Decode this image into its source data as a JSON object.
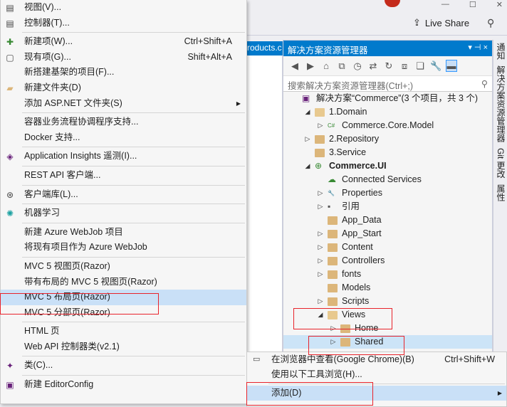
{
  "titlebar": {
    "live_share": "Live Share"
  },
  "editor": {
    "tab_fragment": "roducts.c"
  },
  "solution_explorer": {
    "title": "解决方案资源管理器",
    "title_controls": "▾ ⊣ ×",
    "search_placeholder": "搜索解决方案资源管理器(Ctrl+;)",
    "tree": [
      {
        "label": "解决方案“Commerce”(3 个项目，共 3 个)",
        "level": 0,
        "arrow": "",
        "icon": "solution-icon"
      },
      {
        "label": "1.Domain",
        "level": 1,
        "arrow": "◢",
        "icon": "folder-open-icon"
      },
      {
        "label": "Commerce.Core.Model",
        "level": 2,
        "arrow": "▷",
        "icon": "csharp-project-icon"
      },
      {
        "label": "2.Repository",
        "level": 1,
        "arrow": "▷",
        "icon": "folder-icon"
      },
      {
        "label": "3.Service",
        "level": 1,
        "arrow": "",
        "icon": "folder-icon"
      },
      {
        "label": "Commerce.UI",
        "level": 1,
        "arrow": "◢",
        "icon": "web-project-icon",
        "bold": true
      },
      {
        "label": "Connected Services",
        "level": 2,
        "arrow": "",
        "icon": "connected-services-icon"
      },
      {
        "label": "Properties",
        "level": 2,
        "arrow": "▷",
        "icon": "wrench-icon"
      },
      {
        "label": "引用",
        "level": 2,
        "arrow": "▷",
        "icon": "references-icon"
      },
      {
        "label": "App_Data",
        "level": 2,
        "arrow": "",
        "icon": "folder-icon"
      },
      {
        "label": "App_Start",
        "level": 2,
        "arrow": "▷",
        "icon": "folder-icon"
      },
      {
        "label": "Content",
        "level": 2,
        "arrow": "▷",
        "icon": "folder-icon"
      },
      {
        "label": "Controllers",
        "level": 2,
        "arrow": "▷",
        "icon": "folder-icon"
      },
      {
        "label": "fonts",
        "level": 2,
        "arrow": "▷",
        "icon": "folder-icon"
      },
      {
        "label": "Models",
        "level": 2,
        "arrow": "",
        "icon": "folder-icon"
      },
      {
        "label": "Scripts",
        "level": 2,
        "arrow": "▷",
        "icon": "folder-icon"
      },
      {
        "label": "Views",
        "level": 2,
        "arrow": "◢",
        "icon": "folder-open-icon"
      },
      {
        "label": "Home",
        "level": 3,
        "arrow": "▷",
        "icon": "folder-icon"
      },
      {
        "label": "Shared",
        "level": 3,
        "arrow": "▷",
        "icon": "folder-icon",
        "selected": true
      }
    ]
  },
  "vertical_tabs": [
    "通知",
    "解决方案资源管理器",
    "Git 更改",
    "属性"
  ],
  "context_menu": {
    "items": [
      {
        "label": "视图(V)...",
        "icon": "view-icon"
      },
      {
        "label": "控制器(T)...",
        "icon": "controller-icon"
      },
      {
        "sep": true
      },
      {
        "label": "新建项(W)...",
        "shortcut": "Ctrl+Shift+A",
        "icon": "new-item-icon"
      },
      {
        "label": "现有项(G)...",
        "shortcut": "Shift+Alt+A",
        "icon": "existing-item-icon"
      },
      {
        "label": "新搭建基架的项目(F)...",
        "icon": ""
      },
      {
        "label": "新建文件夹(D)",
        "icon": "new-folder-icon"
      },
      {
        "label": "添加 ASP.NET 文件夹(S)",
        "icon": "",
        "submenu": true
      },
      {
        "sep": true
      },
      {
        "label": "容器业务流程协调程序支持...",
        "icon": ""
      },
      {
        "label": "Docker 支持...",
        "icon": ""
      },
      {
        "sep": true
      },
      {
        "label": "Application Insights 遥测(I)...",
        "icon": "app-insights-icon"
      },
      {
        "sep": true
      },
      {
        "label": "REST API 客户端...",
        "icon": ""
      },
      {
        "sep": true
      },
      {
        "label": "客户端库(L)...",
        "icon": "client-library-icon"
      },
      {
        "sep": true
      },
      {
        "label": "机器学习",
        "icon": "machine-learning-icon"
      },
      {
        "sep": true
      },
      {
        "label": "新建 Azure WebJob 项目",
        "icon": ""
      },
      {
        "label": "将现有项目作为 Azure WebJob",
        "icon": ""
      },
      {
        "sep": true
      },
      {
        "label": "MVC 5 视图页(Razor)",
        "icon": ""
      },
      {
        "label": "带有布局的 MVC 5 视图页(Razor)",
        "icon": ""
      },
      {
        "label": "MVC 5 布局页(Razor)",
        "icon": "",
        "highlight": true
      },
      {
        "label": "MVC 5 分部页(Razor)",
        "icon": ""
      },
      {
        "sep": true
      },
      {
        "label": "HTML 页",
        "icon": ""
      },
      {
        "label": "Web API 控制器类(v2.1)",
        "icon": ""
      },
      {
        "sep": true
      },
      {
        "label": "类(C)...",
        "icon": "class-icon"
      },
      {
        "sep": true
      },
      {
        "label": "新建 EditorConfig",
        "icon": "editorconfig-icon"
      }
    ]
  },
  "parent_menu": {
    "items": [
      {
        "label": "在浏览器中查看(Google Chrome)(B)",
        "shortcut": "Ctrl+Shift+W",
        "icon": "browser-icon"
      },
      {
        "label": "使用以下工具浏览(H)...",
        "shortcut": ""
      },
      {
        "sep": true
      },
      {
        "label": "添加(D)",
        "submenu": true,
        "highlight": true
      }
    ]
  },
  "colors": {
    "accent": "#007acc",
    "highlight": "#c9e0f7",
    "annotation_red": "#e8232b",
    "folder": "#dcb67a"
  }
}
